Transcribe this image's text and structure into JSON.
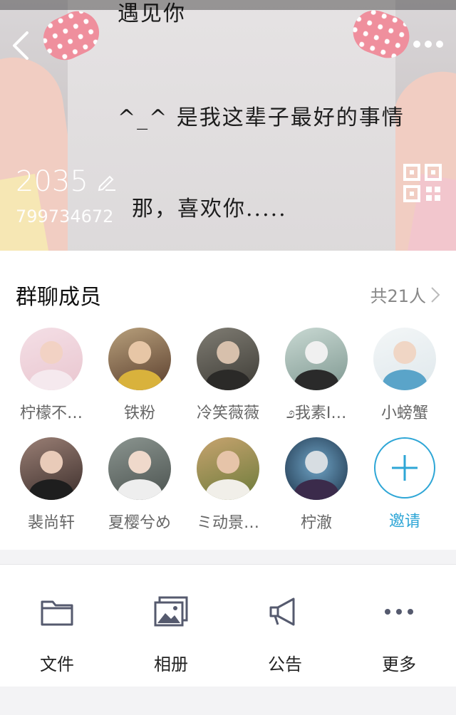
{
  "header": {
    "handwriting": {
      "top": "遇见你",
      "middle": "^_^ 是我这辈子最好的事情",
      "bottom": "那，喜欢你....."
    },
    "group_name": "2035",
    "group_id": "799734672",
    "icons": {
      "back": "back-arrow-icon",
      "more": "more-dots-icon",
      "edit": "pencil-icon",
      "qr": "qr-code-icon"
    }
  },
  "members": {
    "title": "群聊成员",
    "count_label": "共21人",
    "list": [
      {
        "name": "柠檬不…"
      },
      {
        "name": "铁粉"
      },
      {
        "name": "冷笑薇薇"
      },
      {
        "name": "೨我素I…"
      },
      {
        "name": "小螃蟹"
      },
      {
        "name": "裴尚轩"
      },
      {
        "name": "夏樱兮め"
      },
      {
        "name": "ミ动景…"
      },
      {
        "name": "柠澈"
      }
    ],
    "invite_label": "邀请",
    "accent_color": "#2ea6d6"
  },
  "actions": [
    {
      "label": "文件",
      "icon": "folder-icon"
    },
    {
      "label": "相册",
      "icon": "photo-album-icon"
    },
    {
      "label": "公告",
      "icon": "megaphone-icon"
    },
    {
      "label": "更多",
      "icon": "more-dots-icon"
    }
  ]
}
